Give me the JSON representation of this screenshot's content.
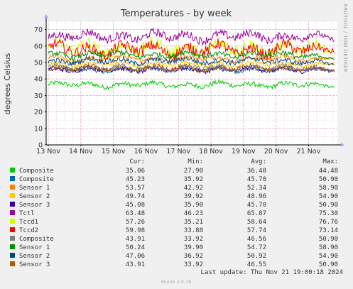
{
  "colors": {
    "background": "#f0f0f0",
    "plot_background": "#ffffff",
    "minor_grid": "#e7b3b3",
    "major_grid": "#d4a0d4"
  },
  "chart_data": {
    "type": "line",
    "title": "Temperatures - by week",
    "ylabel": "degrees Celsius",
    "side_label": "RRDTOOL / TOBI OETIKER",
    "ylim": [
      0,
      75
    ],
    "yticks": [
      0,
      10,
      20,
      30,
      40,
      50,
      60,
      70
    ],
    "xlim": [
      "2024-11-13 00:00",
      "2024-11-21 19:00"
    ],
    "xticks": [
      "13 Nov",
      "14 Nov",
      "15 Nov",
      "16 Nov",
      "17 Nov",
      "18 Nov",
      "19 Nov",
      "20 Nov",
      "21 Nov"
    ],
    "grid": true,
    "legend_headers": [
      "Cur:",
      "Min:",
      "Avg:",
      "Max:"
    ],
    "series": [
      {
        "name": "Composite",
        "color": "#00cc00",
        "cur": "35.06",
        "min": "27.90",
        "avg": "36.48",
        "max": "44.48"
      },
      {
        "name": "Composite",
        "color": "#0066b3",
        "cur": "45.23",
        "min": "35.92",
        "avg": "45.70",
        "max": "50.90"
      },
      {
        "name": "Sensor 1",
        "color": "#ff8000",
        "cur": "53.57",
        "min": "42.92",
        "avg": "52.34",
        "max": "58.90"
      },
      {
        "name": "Sensor 2",
        "color": "#ffcc00",
        "cur": "49.74",
        "min": "39.92",
        "avg": "48.96",
        "max": "54.90"
      },
      {
        "name": "Sensor 3",
        "color": "#330099",
        "cur": "45.08",
        "min": "35.90",
        "avg": "45.70",
        "max": "50.90"
      },
      {
        "name": "Tctl",
        "color": "#990099",
        "cur": "63.48",
        "min": "46.23",
        "avg": "65.87",
        "max": "75.30"
      },
      {
        "name": "Tccd1",
        "color": "#ccff00",
        "cur": "57.26",
        "min": "35.21",
        "avg": "58.64",
        "max": "76.76"
      },
      {
        "name": "Tccd2",
        "color": "#ff0000",
        "cur": "59.98",
        "min": "33.88",
        "avg": "57.74",
        "max": "73.14"
      },
      {
        "name": "Composite",
        "color": "#808080",
        "cur": "43.91",
        "min": "33.92",
        "avg": "46.56",
        "max": "50.90"
      },
      {
        "name": "Sensor 1",
        "color": "#008f00",
        "cur": "50.24",
        "min": "39.90",
        "avg": "54.72",
        "max": "58.90"
      },
      {
        "name": "Sensor 2",
        "color": "#00487d",
        "cur": "47.06",
        "min": "36.92",
        "avg": "50.92",
        "max": "54.90"
      },
      {
        "name": "Sensor 3",
        "color": "#b35a00",
        "cur": "43.91",
        "min": "33.92",
        "avg": "46.55",
        "max": "50.90"
      }
    ],
    "last_update": "Last update: Thu Nov 21 19:00:18 2024",
    "footer": "Munin 2.0.76"
  }
}
